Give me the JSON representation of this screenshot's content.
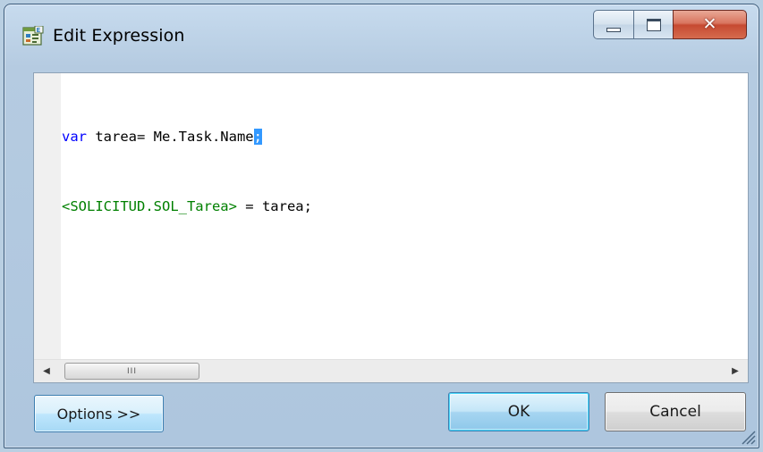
{
  "window": {
    "title": "Edit Expression",
    "controls": {
      "minimize": "minimize",
      "maximize": "maximize",
      "close": "close"
    }
  },
  "editor": {
    "line1": {
      "keyword": "var",
      "text": " tarea= Me.Task.Name",
      "selected": ";"
    },
    "line2": {
      "tag": "<SOLICITUD.SOL_Tarea>",
      "text": " = tarea;"
    },
    "scrollbar": {
      "grip": "III"
    }
  },
  "buttons": {
    "options": "Options >>",
    "ok": "OK",
    "cancel": "Cancel"
  },
  "colors": {
    "keyword": "#0000ff",
    "tag": "#008000",
    "selection": "#3399ff"
  },
  "icons": {
    "title": "expression-editor-icon",
    "close": "close-x-icon",
    "scroll_left": "chevron-left-icon",
    "scroll_right": "chevron-right-icon",
    "resize": "resize-grip-icon"
  }
}
